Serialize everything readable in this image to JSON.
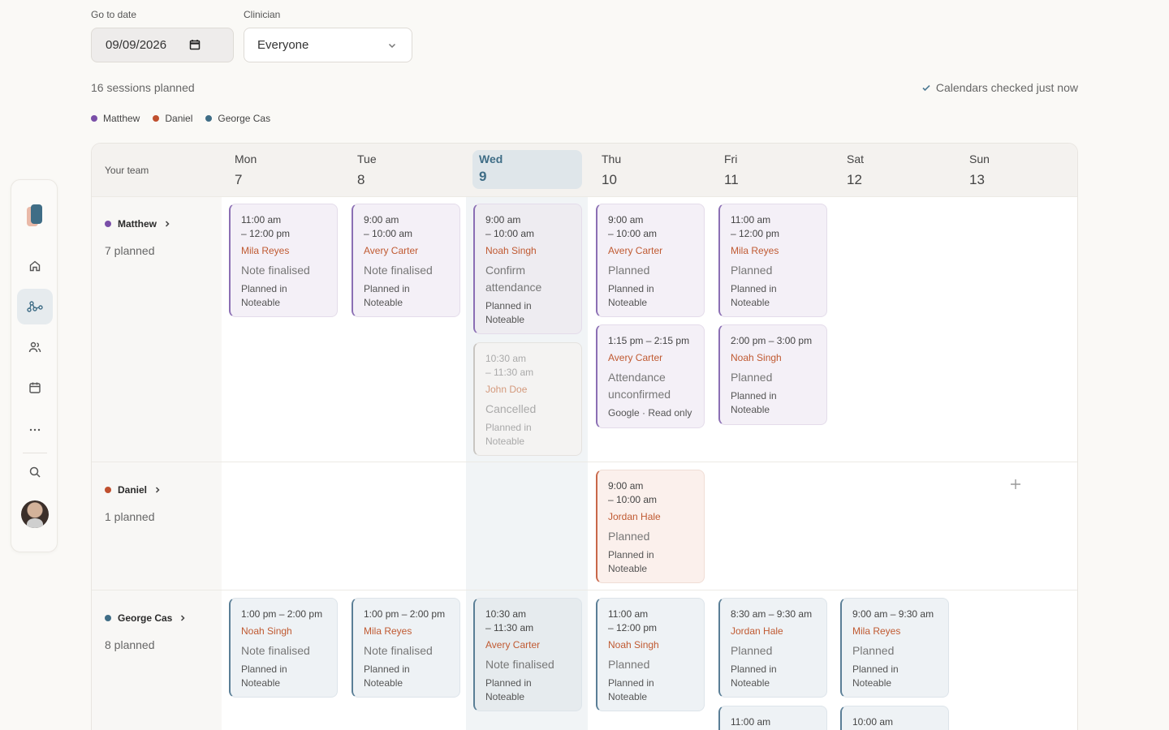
{
  "controls": {
    "date_label": "Go to date",
    "date_value": "09/09/2026",
    "clinician_label": "Clinician",
    "clinician_value": "Everyone"
  },
  "summary": "16 sessions planned",
  "sync_status": "Calendars checked just now",
  "legend": [
    {
      "name": "Matthew",
      "color": "#7a4fa8"
    },
    {
      "name": "Daniel",
      "color": "#c0502f"
    },
    {
      "name": "George Cas",
      "color": "#3f6d86"
    }
  ],
  "board": {
    "team_label": "Your team",
    "days": [
      {
        "name": "Mon",
        "date": "7"
      },
      {
        "name": "Tue",
        "date": "8"
      },
      {
        "name": "Wed",
        "date": "9"
      },
      {
        "name": "Thu",
        "date": "10"
      },
      {
        "name": "Fri",
        "date": "11"
      },
      {
        "name": "Sat",
        "date": "12"
      },
      {
        "name": "Sun",
        "date": "13"
      }
    ],
    "members": [
      {
        "name": "Matthew",
        "count": "7 planned"
      },
      {
        "name": "Daniel",
        "count": "1 planned"
      },
      {
        "name": "George Cas",
        "count": "8 planned"
      }
    ]
  },
  "sessions": {
    "m_mon": {
      "time": "11:00 am",
      "time2": "– 12:00 pm",
      "client": "Mila Reyes",
      "status": "Note finalised",
      "src": "Planned in",
      "src2": "Noteable"
    },
    "m_tue": {
      "time": "9:00 am",
      "time2": "– 10:00 am",
      "client": "Avery Carter",
      "status": "Note finalised",
      "src": "Planned in",
      "src2": "Noteable"
    },
    "m_wed": {
      "time": "9:00 am",
      "time2": "– 10:00 am",
      "client": "Noah Singh",
      "status": "Confirm",
      "status2": "attendance",
      "src": "Planned in",
      "src2": "Noteable"
    },
    "m_wed2": {
      "time": "10:30 am",
      "time2": "– 11:30 am",
      "client": "John Doe",
      "status": "Cancelled",
      "src": "Planned in",
      "src2": "Noteable"
    },
    "m_thu": {
      "time": "9:00 am",
      "time2": "– 10:00 am",
      "client": "Avery Carter",
      "status": "Planned",
      "src": "Planned in",
      "src2": "Noteable"
    },
    "m_thu2": {
      "time": "1:15 pm – 2:15 pm",
      "client": "Avery Carter",
      "status": "Attendance",
      "status2": "unconfirmed",
      "src": "Google · Read only"
    },
    "m_fri": {
      "time": "11:00 am",
      "time2": "– 12:00 pm",
      "client": "Mila Reyes",
      "status": "Planned",
      "src": "Planned in",
      "src2": "Noteable"
    },
    "m_fri2": {
      "time": "2:00 pm – 3:00 pm",
      "client": "Noah Singh",
      "status": "Planned",
      "src": "Planned in",
      "src2": "Noteable"
    },
    "d_thu": {
      "time": "9:00 am",
      "time2": "– 10:00 am",
      "client": "Jordan Hale",
      "status": "Planned",
      "src": "Planned in",
      "src2": "Noteable"
    },
    "g_mon": {
      "time": "1:00 pm – 2:00 pm",
      "client": "Noah Singh",
      "status": "Note finalised",
      "src": "Planned in",
      "src2": "Noteable"
    },
    "g_tue": {
      "time": "1:00 pm – 2:00 pm",
      "client": "Mila Reyes",
      "status": "Note finalised",
      "src": "Planned in",
      "src2": "Noteable"
    },
    "g_wed": {
      "time": "10:30 am",
      "time2": "– 11:30 am",
      "client": "Avery Carter",
      "status": "Note finalised",
      "src": "Planned in",
      "src2": "Noteable"
    },
    "g_thu": {
      "time": "11:00 am",
      "time2": "– 12:00 pm",
      "client": "Noah Singh",
      "status": "Planned",
      "src": "Planned in",
      "src2": "Noteable"
    },
    "g_fri": {
      "time": "8:30 am – 9:30 am",
      "client": "Jordan Hale",
      "status": "Planned",
      "src": "Planned in",
      "src2": "Noteable"
    },
    "g_sat": {
      "time": "9:00 am – 9:30 am",
      "client": "Mila Reyes",
      "status": "Planned",
      "src": "Planned in",
      "src2": "Noteable"
    },
    "g_fri2": {
      "time": "11:00 am"
    },
    "g_sat2": {
      "time": "10:00 am"
    }
  }
}
